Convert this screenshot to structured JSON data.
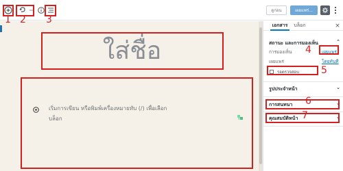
{
  "toolbar": {
    "add_block_icon": "plus-circle-icon",
    "undo_icon": "undo-icon",
    "info_icon": "info-icon",
    "outline_icon": "list-outline-icon",
    "draft_label": "ดูก่อน",
    "publish_label": "เผยแพร่...",
    "settings_icon": "gear-icon",
    "more_icon": "more-vertical-icon"
  },
  "editor": {
    "title_placeholder": "ใส่ชื่อ",
    "block_placeholder_line1": "เริ่มการเขียน หรือพิมพ์เครื่องหมายทับ (/) เพื่อเลือก",
    "block_placeholder_line2": "บล็อก"
  },
  "sidebar": {
    "tabs": [
      "เอกสาร",
      "บล็อก"
    ],
    "status_section_title": "สถานะ และการมองเห็น",
    "visibility_label": "การมองเห็น",
    "visibility_value": "เผยแพร่",
    "publish_label": "เผยแพร่",
    "publish_value": "โดยทันที",
    "pending_review_label": "รอตรวจสอบ",
    "featured_image_title": "รูปประจำหน้า",
    "discussion_title": "การสนทนา",
    "page_attributes_title": "คุณสมบัติหน้า"
  },
  "annotations": [
    "1",
    "2",
    "3",
    "4",
    "5",
    "6",
    "7"
  ],
  "colors": {
    "annotation_red": "#d41f1f",
    "publish_button": "#6fa8d6",
    "editor_background": "#f6f1e8",
    "link_blue": "#0073aa"
  }
}
